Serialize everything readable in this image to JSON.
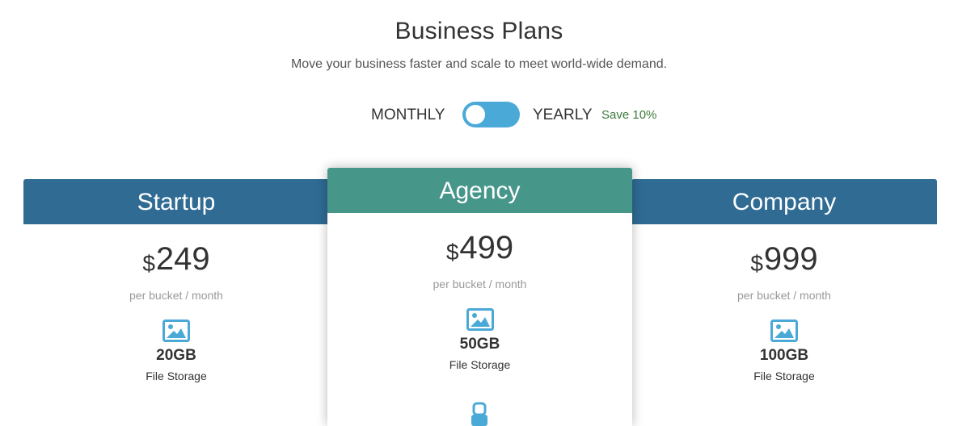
{
  "header": {
    "title": "Business Plans",
    "subtitle": "Move your business faster and scale to meet world-wide demand."
  },
  "billing_toggle": {
    "monthly_label": "MONTHLY",
    "yearly_label": "YEARLY",
    "save_badge": "Save 10%",
    "selected": "MONTHLY"
  },
  "plans": [
    {
      "name": "Startup",
      "currency": "$",
      "price": "249",
      "period": "per bucket / month",
      "storage": "20GB",
      "storage_label": "File Storage",
      "header_color": "#2f6b93"
    },
    {
      "name": "Agency",
      "currency": "$",
      "price": "499",
      "period": "per bucket / month",
      "storage": "50GB",
      "storage_label": "File Storage",
      "header_color": "#46978a",
      "featured": true
    },
    {
      "name": "Company",
      "currency": "$",
      "price": "999",
      "period": "per bucket / month",
      "storage": "100GB",
      "storage_label": "File Storage",
      "header_color": "#2f6b93"
    }
  ],
  "colors": {
    "accent": "#4ba9d8",
    "save": "#3a7a3a",
    "icon": "#4ba9d8"
  },
  "icons": {
    "storage": "image-icon",
    "next_feature": "user-icon"
  }
}
